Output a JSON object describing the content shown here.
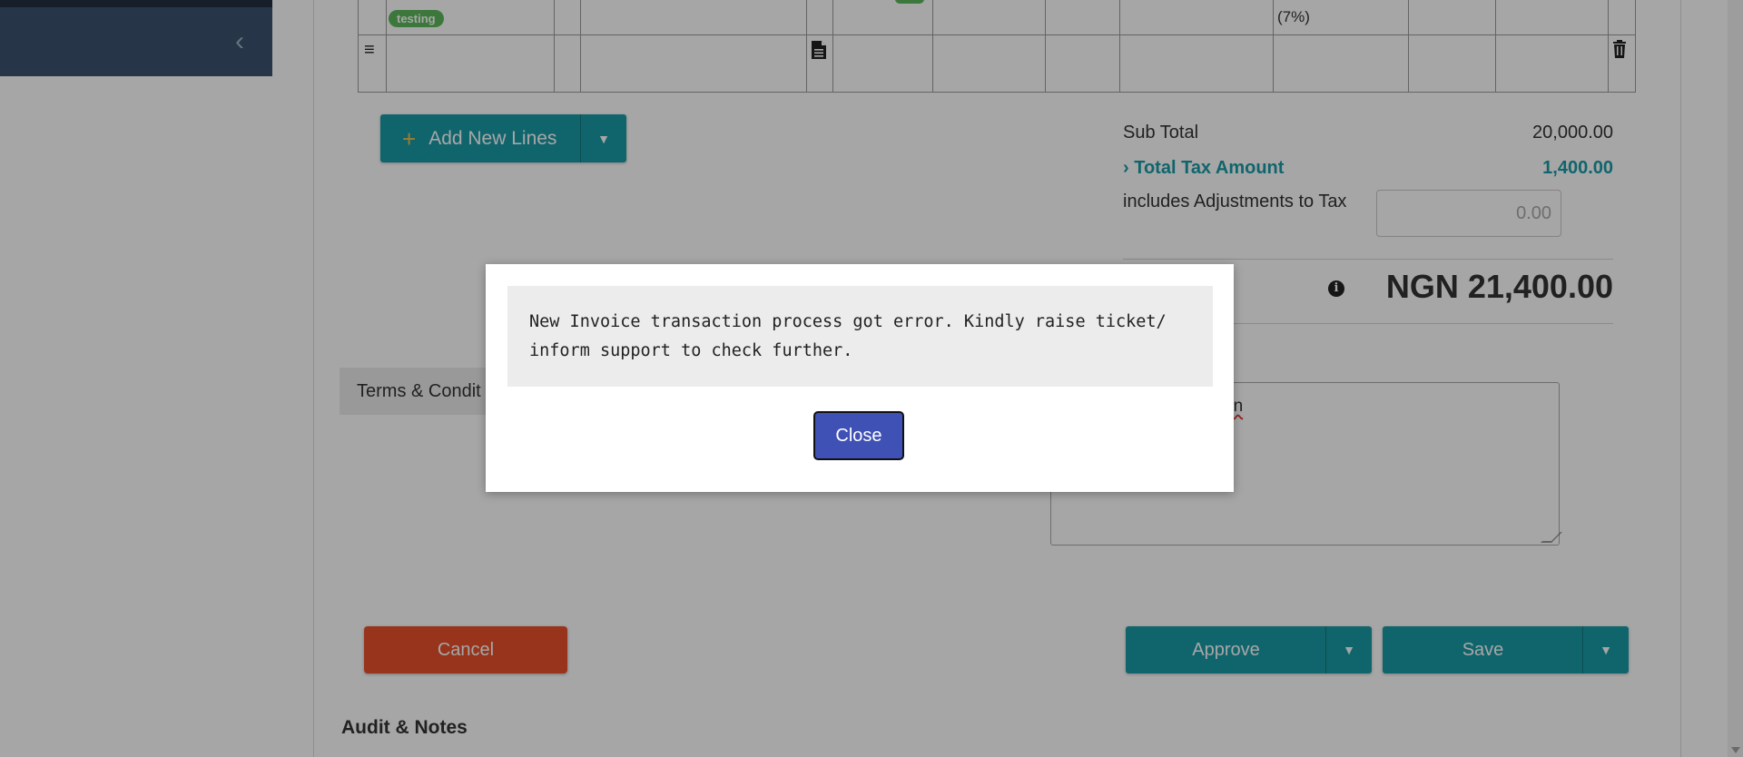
{
  "table": {
    "tag_testing": "testing",
    "tax_cell_text": "(7%)",
    "row_icons": [
      "menu-icon",
      "document-icon",
      "trash-icon"
    ]
  },
  "actions": {
    "add_lines_label": "Add New Lines",
    "cancel_label": "Cancel",
    "approve_label": "Approve",
    "save_label": "Save"
  },
  "totals": {
    "subtotal_label": "Sub Total",
    "subtotal_value": "20,000.00",
    "tax_label": "Total Tax Amount",
    "tax_value": "1,400.00",
    "adjustments_label": "includes Adjustments to Tax",
    "adjustments_value": "0.00",
    "grand_total": "NGN 21,400.00"
  },
  "tabs": {
    "terms_label": "Terms & Condit"
  },
  "notes": {
    "partial_text": "on"
  },
  "sections": {
    "audit_heading": "Audit & Notes"
  },
  "modal": {
    "message": "New Invoice transaction process got error. Kindly raise ticket/\ninform support to check further.",
    "close_label": "Close"
  },
  "colors": {
    "teal": "#1a9ca7",
    "cancel": "#e8502a",
    "modal_button": "#3f51b5",
    "sidebar": "#3b526d"
  }
}
